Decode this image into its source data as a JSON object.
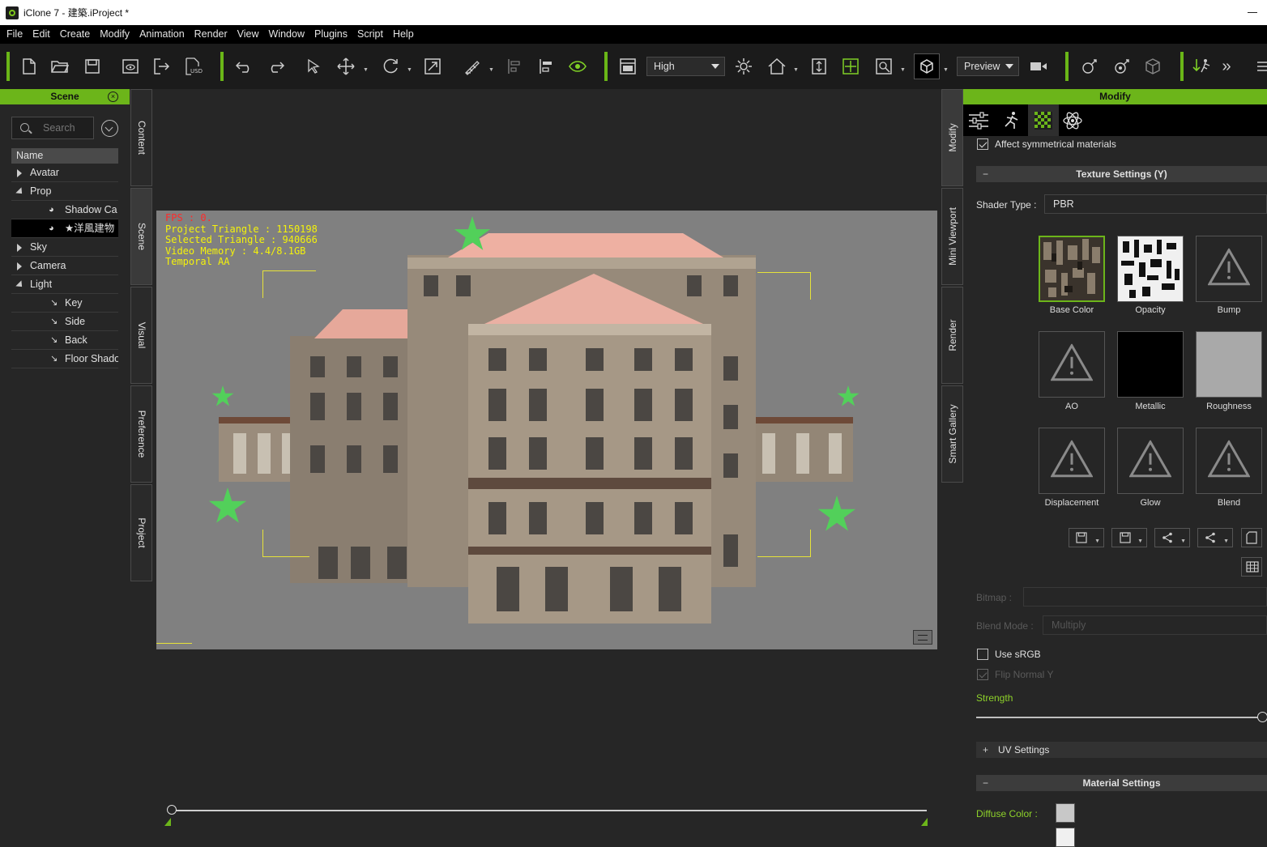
{
  "window": {
    "title": "iClone 7 - 建築.iProject *"
  },
  "menu": [
    "File",
    "Edit",
    "Create",
    "Modify",
    "Animation",
    "Render",
    "View",
    "Window",
    "Plugins",
    "Script",
    "Help"
  ],
  "toolbar": {
    "quality_select": "High",
    "render_select": "Preview",
    "icons": [
      "new-file-icon",
      "open-folder-icon",
      "save-icon",
      "preview-icon",
      "export-icon",
      "usd-icon",
      "undo-icon",
      "redo-icon",
      "select-icon",
      "move-icon",
      "rotate-icon",
      "scale-icon",
      "snap-icon",
      "align-left-icon",
      "align-icon",
      "visibility-eye-icon",
      "layout-icon",
      "light-icon",
      "home-camera-icon",
      "fit-icon",
      "gizmo-icon",
      "view-icon",
      "viewport-box-icon",
      "camera-icon",
      "bone-icon",
      "physics-icon",
      "cube-icon",
      "motion-icon",
      "more-icon",
      "menu-icon"
    ],
    "colors": {
      "accent": "#6cb51a"
    }
  },
  "scene_panel": {
    "title": "Scene",
    "search_placeholder": "Search",
    "column_header": "Name",
    "items": [
      {
        "label": "Avatar",
        "level": 0,
        "expander": "collapsed"
      },
      {
        "label": "Prop",
        "level": 0,
        "expander": "expanded"
      },
      {
        "label": "Shadow Ca",
        "level": 1,
        "icon": "prop-icon"
      },
      {
        "label": "★洋風建物",
        "level": 1,
        "icon": "prop-icon",
        "selected": true
      },
      {
        "label": "Sky",
        "level": 0,
        "expander": "collapsed"
      },
      {
        "label": "Camera",
        "level": 0,
        "expander": "collapsed"
      },
      {
        "label": "Light",
        "level": 0,
        "expander": "expanded"
      },
      {
        "label": "Key",
        "level": 1,
        "icon": "light-icon"
      },
      {
        "label": "Side",
        "level": 1,
        "icon": "light-icon"
      },
      {
        "label": "Back",
        "level": 1,
        "icon": "light-icon"
      },
      {
        "label": "Floor Shado",
        "level": 1,
        "icon": "light-icon"
      }
    ]
  },
  "left_tabs": [
    "Content",
    "Scene",
    "Visual",
    "Preference",
    "Project"
  ],
  "viewport": {
    "hud": {
      "fps": "FPS : 0.",
      "project_triangle": "Project Triangle : 1150198",
      "selected_triangle": "Selected Triangle : 940666",
      "video_memory": "Video Memory : 4.4/8.1GB",
      "temporal": "Temporal AA"
    }
  },
  "right_tabs": [
    "Modify",
    "Mini Viewport",
    "Render",
    "Smart Gallery"
  ],
  "modify_panel": {
    "title": "Modify",
    "tabs": [
      "sliders-icon",
      "motion-pose-icon",
      "material-checker-icon",
      "physics-atom-icon"
    ],
    "affect_symmetrical": "Affect symmetrical materials",
    "texture_section": "Texture Settings  (Y)",
    "shader_type_label": "Shader Type :",
    "shader_type_value": "PBR",
    "texture_slots": [
      "Base Color",
      "Opacity",
      "Bump",
      "AO",
      "Metallic",
      "Roughness",
      "Displacement",
      "Glow",
      "Blend"
    ],
    "bitmap_label": "Bitmap :",
    "blend_mode_label": "Blend Mode :",
    "blend_mode_value": "Multiply",
    "use_srgb": "Use sRGB",
    "flip_normal": "Flip Normal Y",
    "strength_label": "Strength",
    "strength_value": 1.0,
    "uv_section": "UV Settings",
    "material_section": "Material Settings",
    "diffuse_label": "Diffuse Color :",
    "diffuse_color": "#c8c8c8"
  }
}
